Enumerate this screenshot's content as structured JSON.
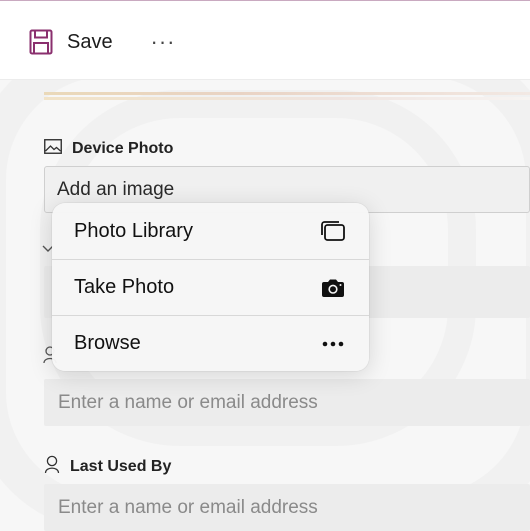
{
  "toolbar": {
    "save_label": "Save",
    "more_label": "···"
  },
  "form": {
    "device_photo": {
      "label": "Device Photo",
      "value": "Add an image"
    },
    "assigned_to": {
      "placeholder": "Enter a name or email address"
    },
    "last_used_by": {
      "label": "Last Used By",
      "placeholder": "Enter a name or email address"
    }
  },
  "image_menu": {
    "items": [
      {
        "label": "Photo Library",
        "icon": "photo-library-icon"
      },
      {
        "label": "Take Photo",
        "icon": "camera-icon"
      },
      {
        "label": "Browse",
        "icon": "ellipsis-icon"
      }
    ]
  },
  "colors": {
    "accent": "#8a2f6e",
    "input_bg": "#ececec",
    "form_bg": "#f7f7f7"
  }
}
